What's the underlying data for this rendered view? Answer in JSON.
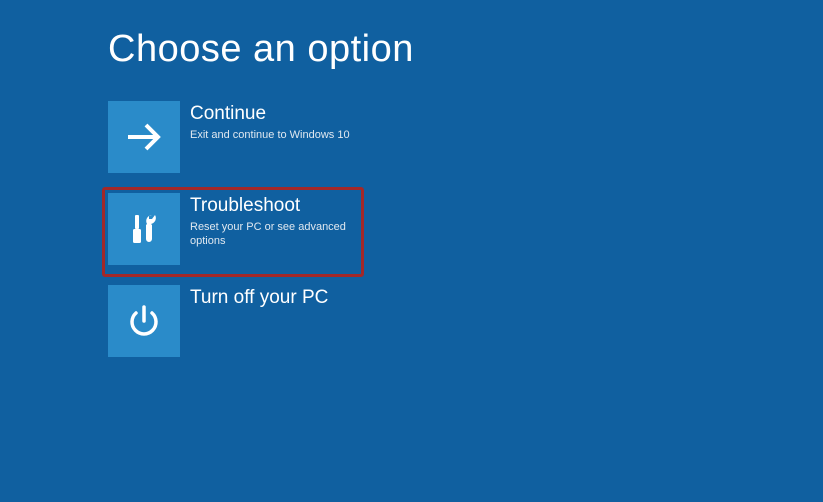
{
  "page_title": "Choose an option",
  "options": [
    {
      "title": "Continue",
      "description": "Exit and continue to Windows 10",
      "icon": "arrow-right-icon",
      "highlighted": false
    },
    {
      "title": "Troubleshoot",
      "description": "Reset your PC or see advanced options",
      "icon": "tools-icon",
      "highlighted": true
    },
    {
      "title": "Turn off your PC",
      "description": "",
      "icon": "power-icon",
      "highlighted": false
    }
  ],
  "colors": {
    "background": "#1060a0",
    "tile": "#2a8bc9",
    "highlight_border": "#a32828"
  }
}
